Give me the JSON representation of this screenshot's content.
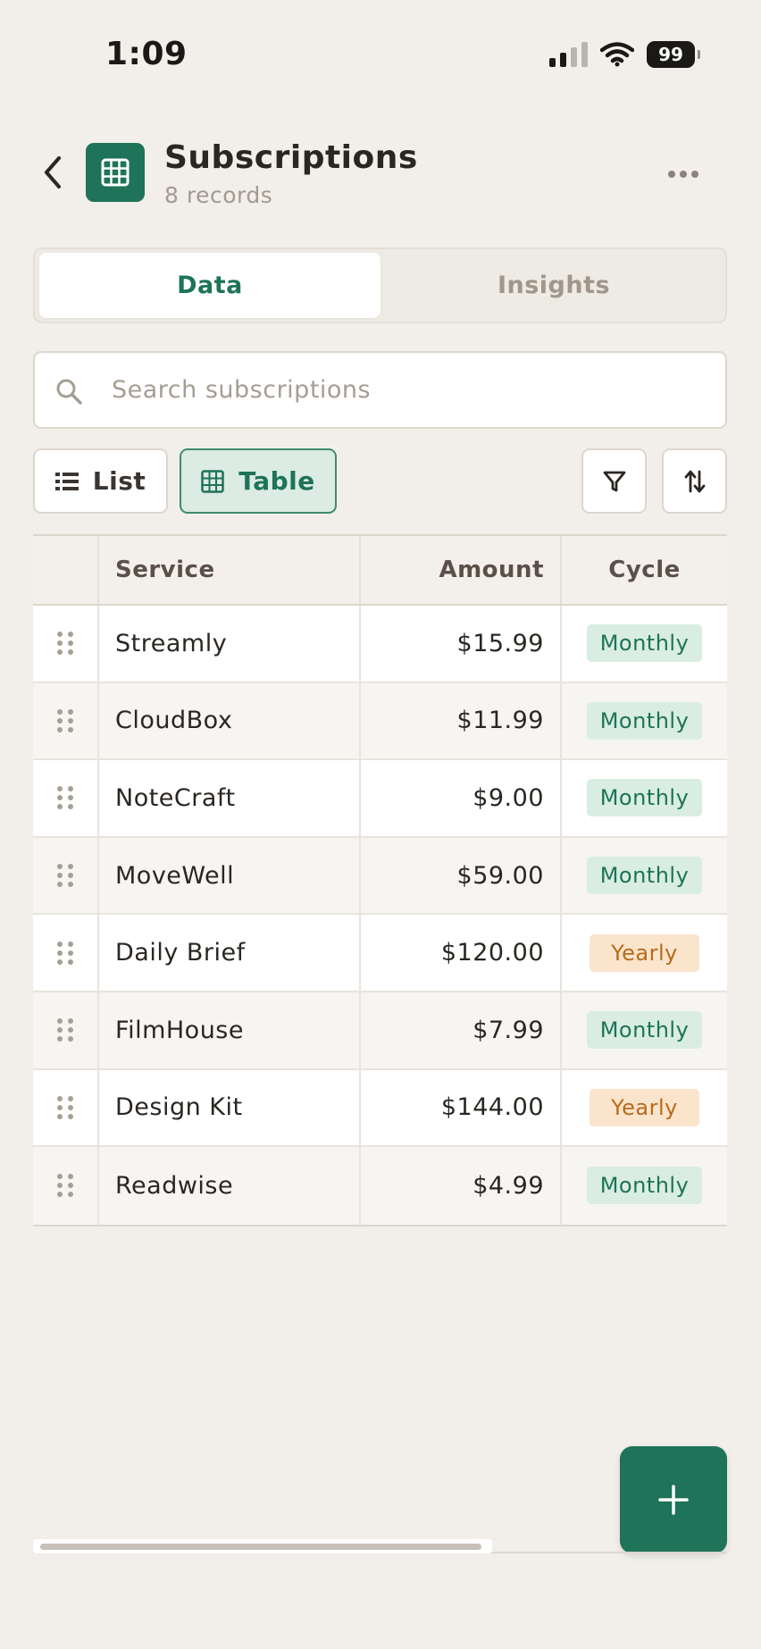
{
  "status_bar": {
    "time": "1:09",
    "battery": "99"
  },
  "header": {
    "title": "Subscriptions",
    "subtitle": "8 records",
    "app_icon": "table-grid-icon",
    "accent_color": "#1e7358"
  },
  "tabs": [
    {
      "label": "Data",
      "active": true
    },
    {
      "label": "Insights",
      "active": false
    }
  ],
  "search": {
    "placeholder": "Search subscriptions",
    "value": ""
  },
  "view_toggle": {
    "list_label": "List",
    "table_label": "Table",
    "selected": "Table"
  },
  "toolbar": {
    "filter_icon": "filter-icon",
    "sort_icon": "sort-icon"
  },
  "table": {
    "columns": [
      "Service",
      "Amount",
      "Cycle"
    ],
    "rows": [
      {
        "service": "Streamly",
        "amount": "$15.99",
        "cycle": "Monthly"
      },
      {
        "service": "CloudBox",
        "amount": "$11.99",
        "cycle": "Monthly"
      },
      {
        "service": "NoteCraft",
        "amount": "$9.00",
        "cycle": "Monthly"
      },
      {
        "service": "MoveWell",
        "amount": "$59.00",
        "cycle": "Monthly"
      },
      {
        "service": "Daily Brief",
        "amount": "$120.00",
        "cycle": "Yearly"
      },
      {
        "service": "FilmHouse",
        "amount": "$7.99",
        "cycle": "Monthly"
      },
      {
        "service": "Design Kit",
        "amount": "$144.00",
        "cycle": "Yearly"
      },
      {
        "service": "Readwise",
        "amount": "$4.99",
        "cycle": "Monthly"
      }
    ]
  },
  "colors": {
    "monthly_badge_bg": "#d9ede3",
    "monthly_badge_text": "#1e7358",
    "yearly_badge_bg": "#fbe4cc",
    "yearly_badge_text": "#b86a1a"
  },
  "fab": {
    "icon": "plus-icon"
  }
}
